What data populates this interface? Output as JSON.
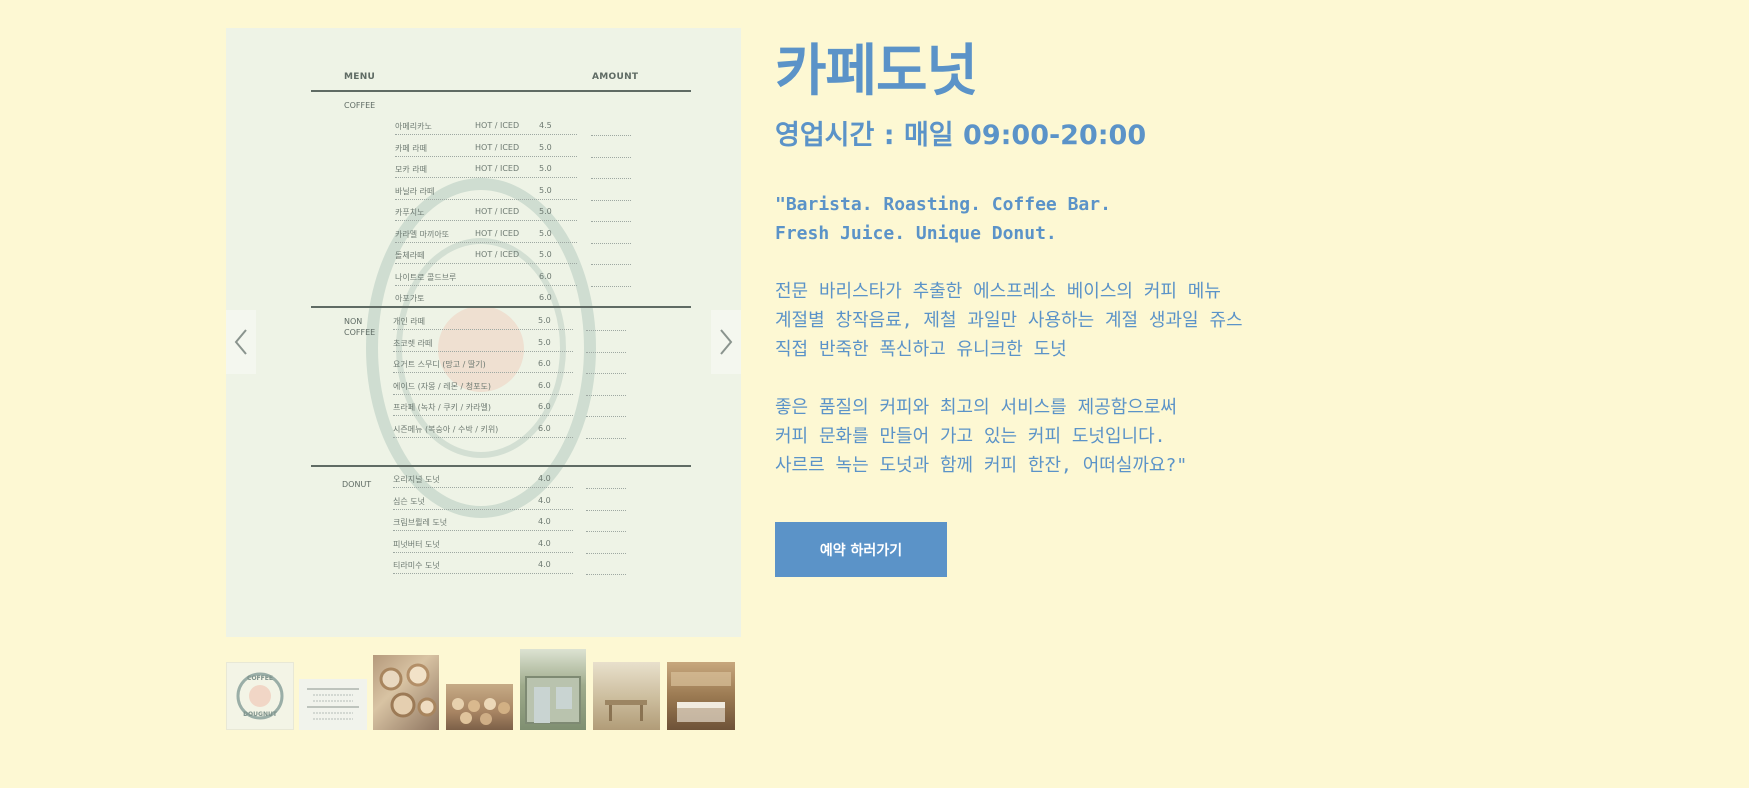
{
  "gallery": {
    "menu": {
      "header_menu": "MENU",
      "header_amount": "AMOUNT",
      "sections": [
        {
          "category": "COFFEE",
          "items": [
            {
              "name": "아메리카노",
              "type": "HOT / ICED",
              "price": "4.5"
            },
            {
              "name": "카페 라떼",
              "type": "HOT / ICED",
              "price": "5.0"
            },
            {
              "name": "모카 라떼",
              "type": "HOT / ICED",
              "price": "5.0"
            },
            {
              "name": "바닐라 라떼",
              "type": "",
              "price": "5.0"
            },
            {
              "name": "카푸치노",
              "type": "HOT / ICED",
              "price": "5.0"
            },
            {
              "name": "카라멜 마끼아또",
              "type": "HOT / ICED",
              "price": "5.0"
            },
            {
              "name": "돌체라떼",
              "type": "HOT / ICED",
              "price": "5.0"
            },
            {
              "name": "나이트로 콜드브루",
              "type": "",
              "price": "6.0"
            },
            {
              "name": "아포가토",
              "type": "",
              "price": "6.0"
            }
          ]
        },
        {
          "category": "NON COFFEE",
          "items": [
            {
              "name": "개인 라떼",
              "type": "",
              "price": "5.0"
            },
            {
              "name": "초코렛 라떼",
              "type": "",
              "price": "5.0"
            },
            {
              "name": "요거트 스무디 (망고 / 딸기)",
              "type": "",
              "price": "6.0"
            },
            {
              "name": "에이드 (자몽 / 레몬 / 청포도)",
              "type": "",
              "price": "6.0"
            },
            {
              "name": "프라페 (녹차 / 쿠키 / 카라멜)",
              "type": "",
              "price": "6.0"
            },
            {
              "name": "시즌메뉴 (복숭아 / 수박 / 키위)",
              "type": "",
              "price": "6.0"
            }
          ]
        },
        {
          "category": "DONUT",
          "items": [
            {
              "name": "오리지널 도넛",
              "type": "",
              "price": "4.0"
            },
            {
              "name": "심슨 도넛",
              "type": "",
              "price": "4.0"
            },
            {
              "name": "크림브륄레 도넛",
              "type": "",
              "price": "4.0"
            },
            {
              "name": "피넛버터 도넛",
              "type": "",
              "price": "4.0"
            },
            {
              "name": "티라미수 도넛",
              "type": "",
              "price": "4.0"
            }
          ]
        }
      ]
    },
    "prev_icon": "chevron-left-icon",
    "next_icon": "chevron-right-icon",
    "thumbnails": [
      {
        "name": "logo",
        "caption": "COFFEE DOUGNUT"
      },
      {
        "name": "menu",
        "caption": ""
      },
      {
        "name": "donuts-box",
        "caption": ""
      },
      {
        "name": "donut-display",
        "caption": ""
      },
      {
        "name": "storefront",
        "caption": ""
      },
      {
        "name": "interior-seating",
        "caption": ""
      },
      {
        "name": "interior-bar",
        "caption": ""
      }
    ]
  },
  "info": {
    "title": "카페도넛",
    "hours": "영업시간 : 매일 09:00-20:00",
    "tagline": "\"Barista. Roasting. Coffee Bar.\nFresh Juice. Unique Donut.",
    "paragraph1": "전문 바리스타가 추출한 에스프레소 베이스의 커피 메뉴\n계절별 창작음료, 제철 과일만 사용하는 계절 생과일 쥬스\n직접 반죽한 폭신하고 유니크한 도넛",
    "paragraph2": "좋은 품질의 커피와 최고의 서비스를 제공함으로써\n커피 문화를 만들어 가고 있는 커피 도넛입니다.\n사르르 녹는 도넛과 함께 커피 한잔, 어떠실까요?\""
  },
  "reserve_button": "예약 하러가기",
  "colors": {
    "background": "#fdf8d3",
    "accent": "#5b93c8"
  }
}
